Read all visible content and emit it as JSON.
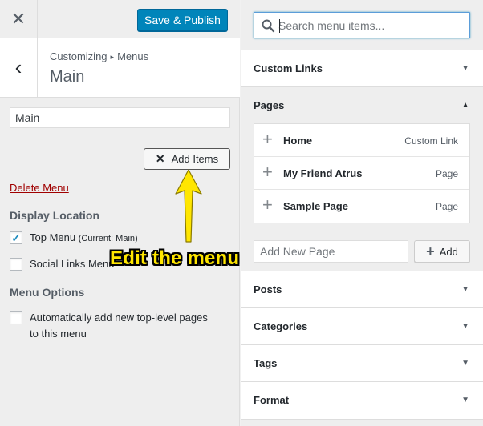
{
  "topbar": {
    "close_icon": "close-icon",
    "publish_label": "Save & Publish",
    "publish_color": "#0085ba"
  },
  "header": {
    "breadcrumb_parent": "Customizing",
    "breadcrumb_sep": "▸",
    "breadcrumb_child": "Menus",
    "title": "Main",
    "back_icon": "chevron-left-icon"
  },
  "menu": {
    "name_value": "Main",
    "add_items_label": "Add Items",
    "delete_label": "Delete Menu",
    "delete_color": "#a00000"
  },
  "display_location": {
    "title": "Display Location",
    "options": [
      {
        "label": "Top Menu",
        "note": "(Current: Main)",
        "checked": true
      },
      {
        "label": "Social Links Menu",
        "note": "",
        "checked": false
      }
    ]
  },
  "menu_options": {
    "title": "Menu Options",
    "auto_add_line1": "Automatically add new top-level pages",
    "auto_add_line2": "to this menu",
    "auto_add_checked": false
  },
  "search": {
    "placeholder": "Search menu items..."
  },
  "sections": {
    "custom_links": "Custom Links",
    "pages": "Pages",
    "posts": "Posts",
    "categories": "Categories",
    "tags": "Tags",
    "format": "Format"
  },
  "pages": {
    "items": [
      {
        "title": "Home",
        "type": "Custom Link"
      },
      {
        "title": "My Friend Atrus",
        "type": "Page"
      },
      {
        "title": "Sample Page",
        "type": "Page"
      }
    ],
    "new_page_placeholder": "Add New Page",
    "add_label": "Add"
  },
  "annotation": {
    "text": "Edit the menu",
    "color": "#ffe600"
  }
}
